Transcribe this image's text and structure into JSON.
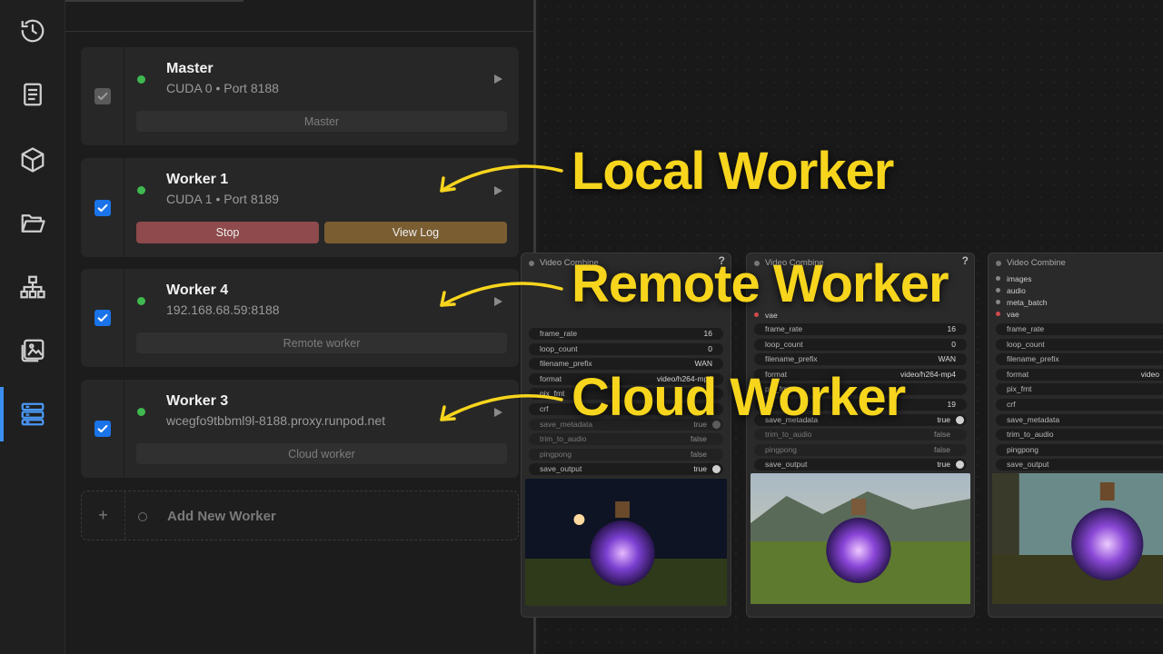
{
  "sidebar": {
    "items": [
      {
        "icon": "history-icon"
      },
      {
        "icon": "book-icon"
      },
      {
        "icon": "cube-icon"
      },
      {
        "icon": "folder-open-icon"
      },
      {
        "icon": "sitemap-icon"
      },
      {
        "icon": "images-icon"
      },
      {
        "icon": "server-stack-icon",
        "active": true
      }
    ],
    "accent": "#3b8ef0"
  },
  "workers": [
    {
      "name": "Master",
      "detail": "CUDA 0 • Port 8188",
      "bar_label": "Master",
      "enabled": true,
      "locked": true
    },
    {
      "name": "Worker 1",
      "detail": "CUDA 1 • Port 8189",
      "stop_label": "Stop",
      "log_label": "View Log",
      "enabled": true
    },
    {
      "name": "Worker 4",
      "detail": "192.168.68.59:8188",
      "bar_label": "Remote worker",
      "enabled": true
    },
    {
      "name": "Worker 3",
      "detail": "wcegfo9tbbml9l-8188.proxy.runpod.net",
      "bar_label": "Cloud worker",
      "enabled": true
    }
  ],
  "add_worker": {
    "icon": "plus-icon",
    "label": "Add New Worker"
  },
  "status_color": "#3fb94f",
  "callouts": {
    "local": "Local Worker",
    "remote": "Remote Worker",
    "cloud": "Cloud Worker",
    "color": "#f7d51d"
  },
  "nodes": [
    {
      "title": "Video Combine",
      "sockets": [],
      "widgets": [
        {
          "label": "frame_rate",
          "value": "16"
        },
        {
          "label": "loop_count",
          "value": "0"
        },
        {
          "label": "filename_prefix",
          "value": "WAN"
        },
        {
          "label": "format",
          "value": "video/h264-mp4"
        },
        {
          "label": "pix_fmt",
          "value": ""
        },
        {
          "label": "crf",
          "value": ""
        },
        {
          "label": "save_metadata",
          "value": "true"
        },
        {
          "label": "trim_to_audio",
          "value": "false"
        },
        {
          "label": "pingpong",
          "value": "false"
        },
        {
          "label": "save_output",
          "value": "true"
        }
      ]
    },
    {
      "title": "Video Combine",
      "sockets": [
        "vae"
      ],
      "widgets": [
        {
          "label": "frame_rate",
          "value": "16"
        },
        {
          "label": "loop_count",
          "value": "0"
        },
        {
          "label": "filename_prefix",
          "value": "WAN"
        },
        {
          "label": "format",
          "value": "video/h264-mp4"
        },
        {
          "label": "pix_fmt",
          "value": ""
        },
        {
          "label": "crf",
          "value": "19"
        },
        {
          "label": "save_metadata",
          "value": "true"
        },
        {
          "label": "trim_to_audio",
          "value": "false"
        },
        {
          "label": "pingpong",
          "value": "false"
        },
        {
          "label": "save_output",
          "value": "true"
        }
      ]
    },
    {
      "title": "Video Combine",
      "sockets": [
        "images",
        "audio",
        "meta_batch",
        "vae"
      ],
      "widgets": [
        {
          "label": "frame_rate",
          "value": ""
        },
        {
          "label": "loop_count",
          "value": ""
        },
        {
          "label": "filename_prefix",
          "value": ""
        },
        {
          "label": "format",
          "value": "video"
        },
        {
          "label": "pix_fmt",
          "value": ""
        },
        {
          "label": "crf",
          "value": ""
        },
        {
          "label": "save_metadata",
          "value": ""
        },
        {
          "label": "trim_to_audio",
          "value": ""
        },
        {
          "label": "pingpong",
          "value": ""
        },
        {
          "label": "save_output",
          "value": ""
        }
      ]
    }
  ]
}
